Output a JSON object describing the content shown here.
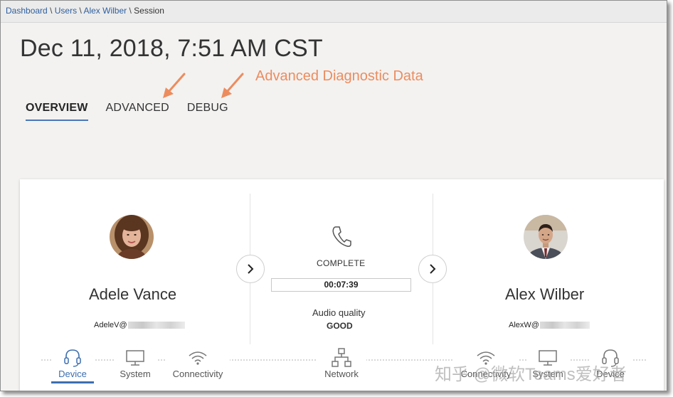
{
  "breadcrumb": {
    "items": [
      "Dashboard",
      "Users",
      "Alex Wilber"
    ],
    "current": "Session",
    "separator": "\\"
  },
  "session": {
    "title": "Dec 11, 2018, 7:51 AM CST"
  },
  "annotation": {
    "text": "Advanced Diagnostic Data",
    "color": "#ec8c5e"
  },
  "tabs": [
    {
      "label": "OVERVIEW",
      "active": true
    },
    {
      "label": "ADVANCED",
      "active": false
    },
    {
      "label": "DEBUG",
      "active": false
    }
  ],
  "caller": {
    "name": "Adele Vance",
    "email_prefix": "AdeleV@"
  },
  "callee": {
    "name": "Alex Wilber",
    "email_prefix": "AlexW@"
  },
  "call": {
    "icon": "phone-icon",
    "status": "COMPLETE",
    "duration": "00:07:39",
    "audio_quality_label": "Audio quality",
    "audio_quality_value": "GOOD"
  },
  "bottom_nav": {
    "left": [
      {
        "label": "Device",
        "icon": "headset-icon",
        "active": true
      },
      {
        "label": "System",
        "icon": "monitor-icon",
        "active": false
      },
      {
        "label": "Connectivity",
        "icon": "wifi-icon",
        "active": false
      }
    ],
    "center": [
      {
        "label": "Network",
        "icon": "network-icon",
        "active": false
      }
    ],
    "right": [
      {
        "label": "Connectivity",
        "icon": "wifi-icon",
        "active": false
      },
      {
        "label": "System",
        "icon": "monitor-icon",
        "active": false
      },
      {
        "label": "Device",
        "icon": "headset-icon",
        "active": false
      }
    ]
  },
  "watermark": "知乎 @微软Teams爱好者",
  "colors": {
    "accent": "#3d6fb0",
    "link": "#2f5f9e",
    "annotation": "#ec8c5e"
  }
}
